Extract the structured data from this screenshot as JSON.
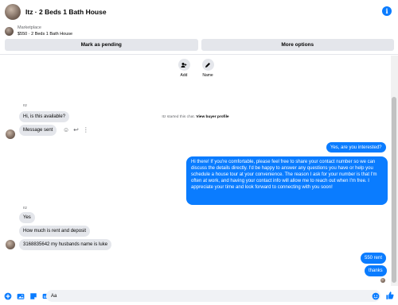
{
  "header": {
    "title": "Itz · 2 Beds 1 Bath House"
  },
  "listing": {
    "category": "Marketplace",
    "name": "$550 · 2 Beds 1 Bath House"
  },
  "actions": {
    "pending": "Mark as pending",
    "more": "More options"
  },
  "quick_actions": [
    {
      "label": "Add"
    },
    {
      "label": "Name"
    }
  ],
  "chat_started": {
    "prefix": "Itz started this chat.",
    "link": "View buyer profile"
  },
  "messages": {
    "sender_1": "Itz",
    "in_1": "Hi, is this available?",
    "in_2": "Message sent",
    "out_1": "Yes, are you interested?",
    "out_2": "Hi there! If you're comfortable, please feel free to share your contact number so we can discuss the details directly. I'd be happy to answer any questions you have or help you schedule a house tour at your convenience. The reason I ask for your number is that I'm often at work, and having your contact info will allow me to reach out when I'm free. I appreciate your time and look forward to connecting with you soon!",
    "sender_2": "Itz",
    "in_3": "Yes",
    "in_4": "How much is rent and deposit",
    "in_5": "3168835642 my husbands name is luke",
    "out_3": "550 rent",
    "out_4": "thanks"
  },
  "composer": {
    "value": "Aa"
  },
  "colors": {
    "accent": "#0a7cff",
    "bubble_in": "#e4e6eb"
  }
}
